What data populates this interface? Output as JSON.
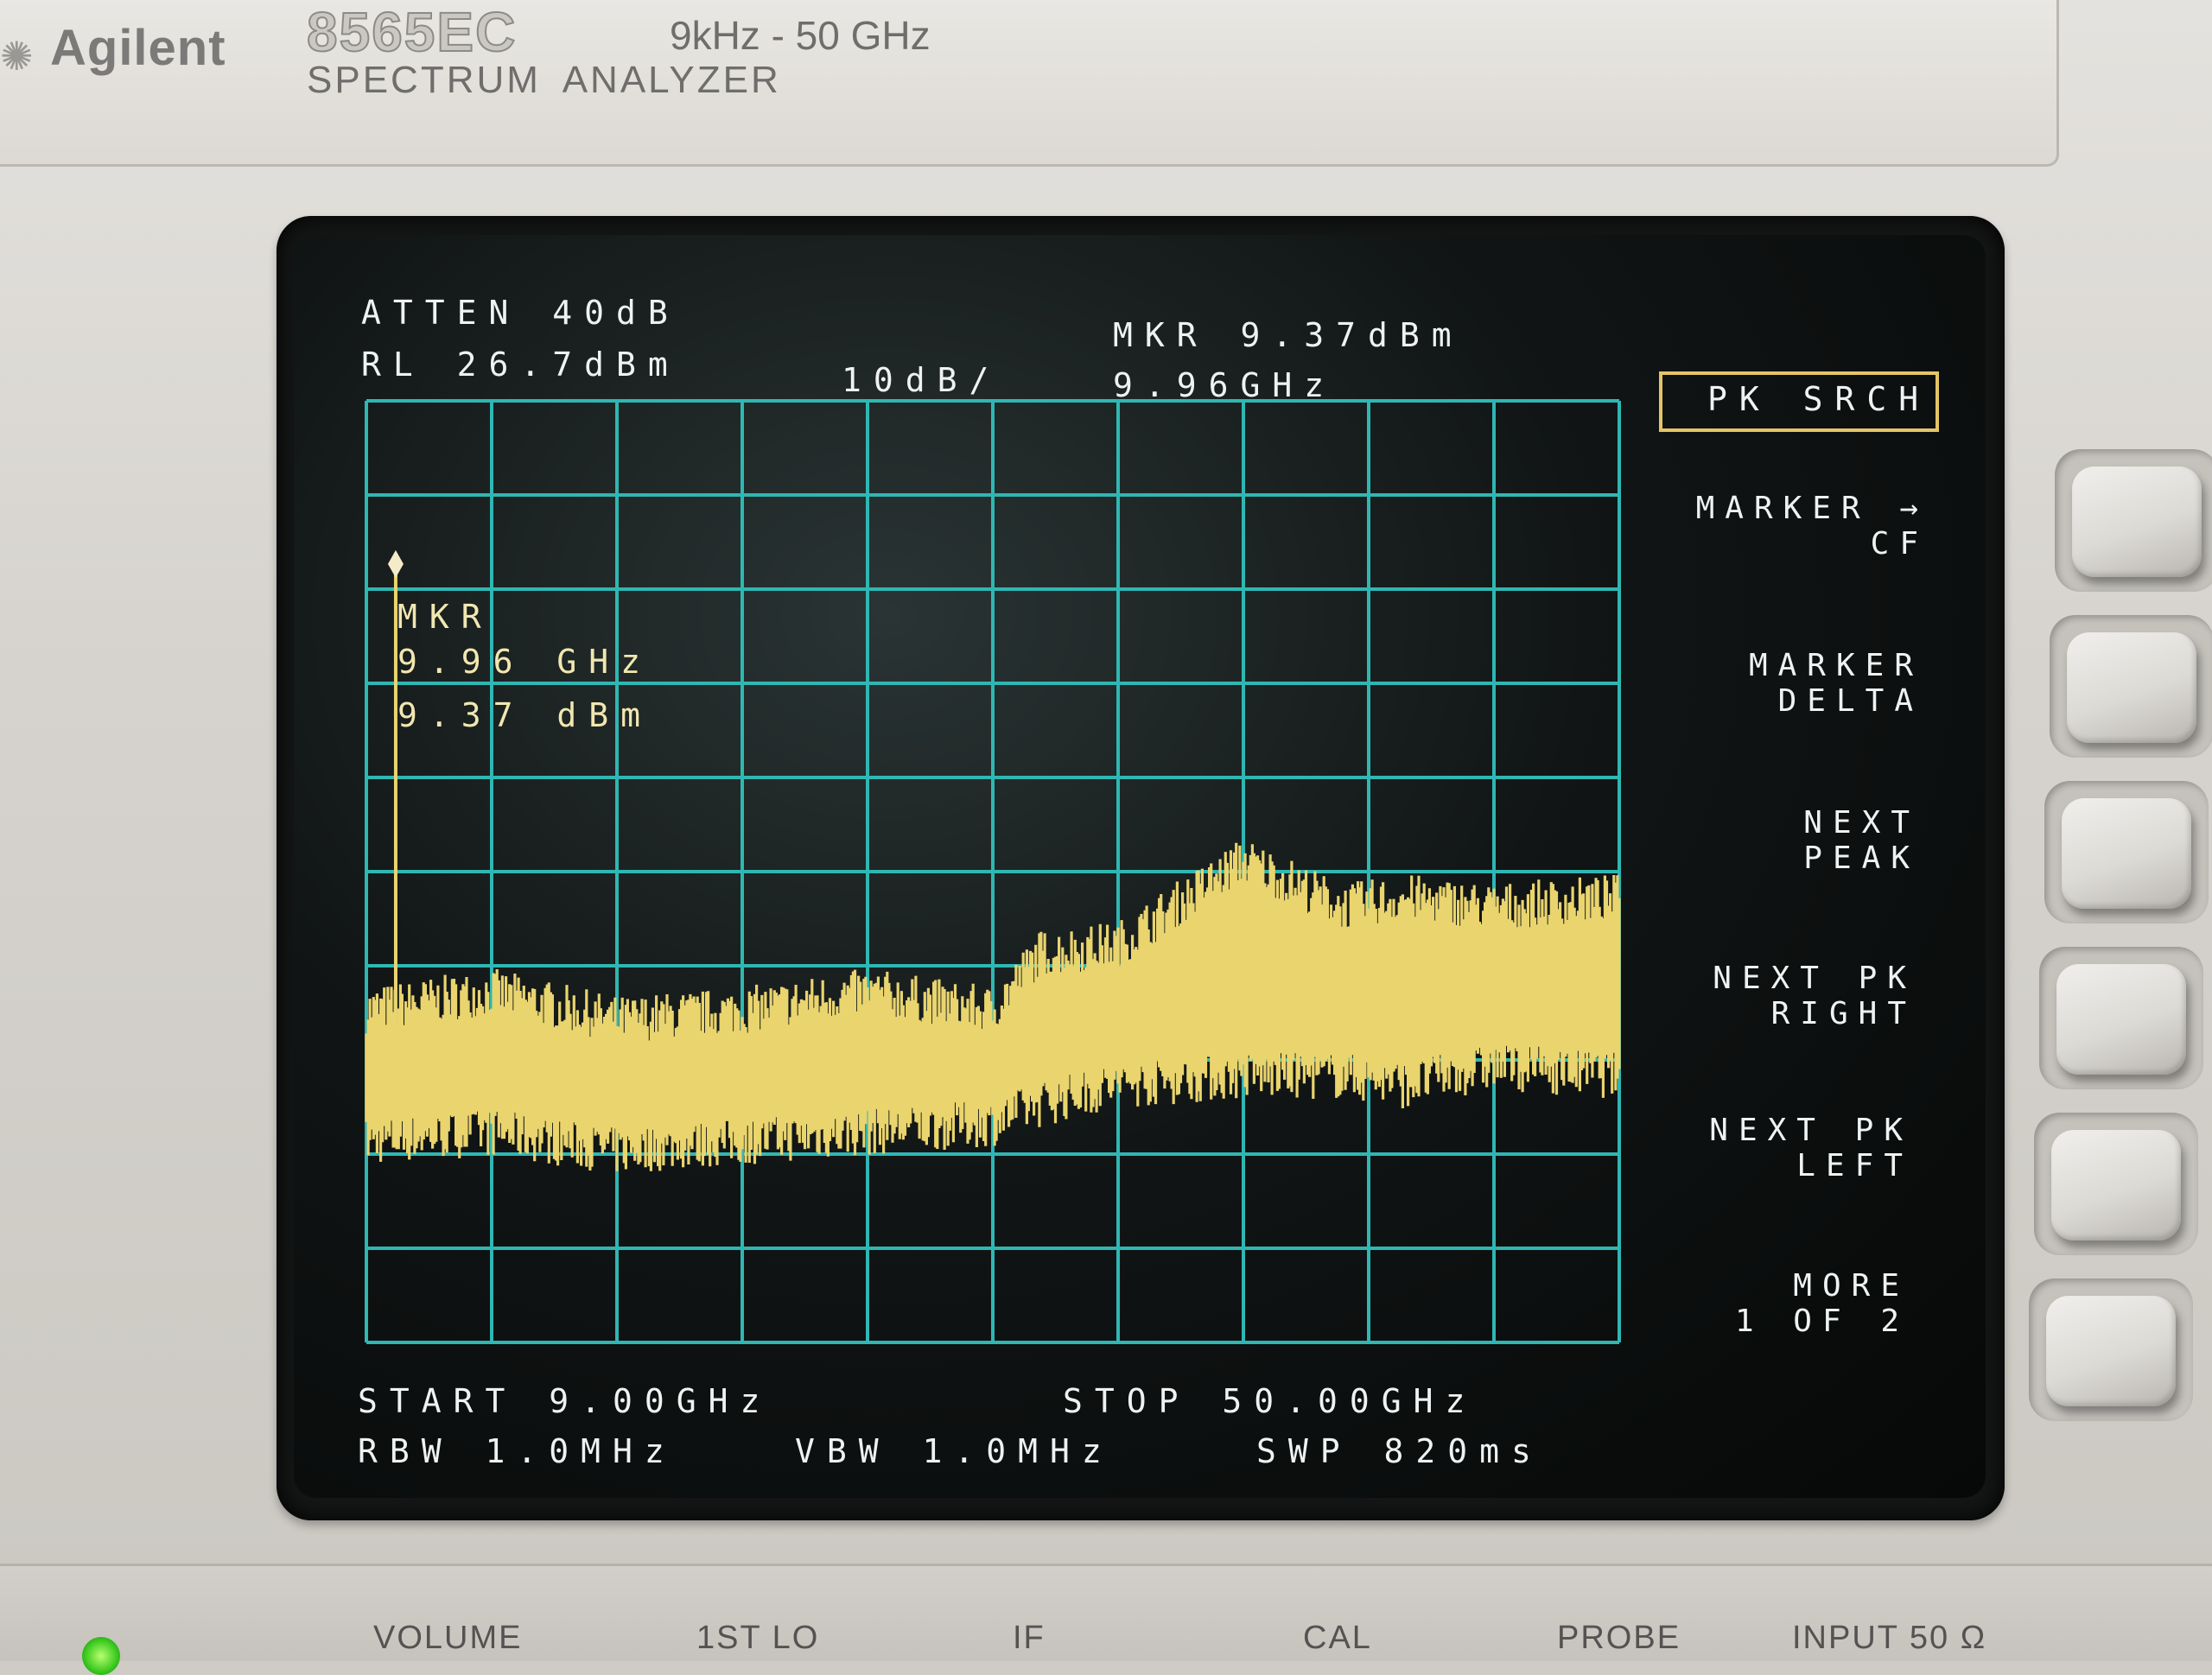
{
  "instrument": {
    "brand": "Agilent",
    "model": "8565EC",
    "frequency_range": "9kHz - 50 GHz",
    "subtitle": "SPECTRUM ANALYZER"
  },
  "display": {
    "atten": "ATTEN 40dB",
    "ref_level": "RL 26.7dBm",
    "scale": "10dB/",
    "marker_readout_line1": "MKR 9.37dBm",
    "marker_readout_line2": "9.96GHz",
    "marker_label": {
      "title": "MKR",
      "freq": "9.96 GHz",
      "amp": "9.37 dBm"
    },
    "start": "START 9.00GHz",
    "stop": "STOP 50.00GHz",
    "rbw": "RBW 1.0MHz",
    "vbw": "VBW 1.0MHz",
    "sweep": "SWP 820ms",
    "trace_color": "#e9d46e",
    "grid_color": "#2fb7b3"
  },
  "softkeys": {
    "menu_title": "PK SRCH",
    "items": [
      {
        "line1": "MARKER →",
        "line2": "CF"
      },
      {
        "line1": "MARKER",
        "line2": "DELTA"
      },
      {
        "line1": "NEXT",
        "line2": "PEAK"
      },
      {
        "line1": "NEXT PK",
        "line2": "RIGHT"
      },
      {
        "line1": "NEXT PK",
        "line2": "LEFT"
      },
      {
        "line1": "MORE",
        "line2": "1 OF 2"
      }
    ]
  },
  "front_panel": {
    "labels": [
      "VOLUME",
      "1ST LO",
      "IF",
      "CAL",
      "PROBE",
      "INPUT 50 Ω"
    ],
    "power_led_color": "#39c81e"
  },
  "chart_data": {
    "type": "line",
    "title": "",
    "xlabel": "",
    "ylabel": "",
    "x_unit": "GHz",
    "y_unit": "dBm",
    "xlim": [
      9.0,
      50.0
    ],
    "ylim": [
      -73.3,
      26.7
    ],
    "grid": true,
    "marker": {
      "x": 9.96,
      "y": 9.37
    },
    "noise_floor": {
      "x": [
        9.0,
        13.1,
        17.2,
        21.3,
        25.4,
        29.5,
        31.0,
        33.6,
        37.7,
        41.0,
        43.0,
        45.9,
        50.0
      ],
      "upper": [
        -38,
        -36,
        -39,
        -38,
        -36,
        -38,
        -32,
        -31,
        -22,
        -27,
        -26,
        -27,
        -26
      ],
      "lower": [
        -52,
        -51,
        -53,
        -52,
        -51,
        -50,
        -48,
        -46,
        -45,
        -45,
        -46,
        -44,
        -45
      ]
    }
  }
}
